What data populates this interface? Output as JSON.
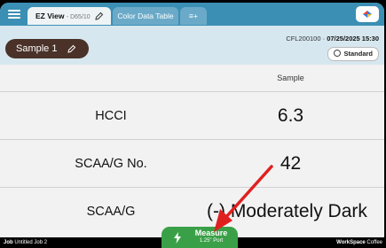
{
  "tabs": [
    {
      "label": "EZ View",
      "sub": "- D65/10"
    },
    {
      "label": "Color Data Table"
    },
    {
      "label": "≡+"
    }
  ],
  "header": {
    "sample_label": "Sample 1",
    "serial": "CFL200100 ·",
    "datetime": "07/25/2025 15:30",
    "standard_label": "Standard"
  },
  "table": {
    "column_header": "Sample",
    "rows": [
      {
        "label": "HCCI",
        "value": "6.3"
      },
      {
        "label": "SCAA/G No.",
        "value": "42"
      },
      {
        "label": "SCAA/G",
        "value": "(-) Moderately Dark"
      }
    ]
  },
  "status": {
    "job_key": "Job",
    "job_value": "Untitled Job 2",
    "workspace_key": "WorkSpace",
    "workspace_value": "Coffee"
  },
  "measure": {
    "label": "Measure",
    "port": "1.25\" Port"
  },
  "colors": {
    "tabbar": "#3b8fb4",
    "measure": "#3aa047",
    "sample_pill": "#4a3228",
    "arrow": "#e02020"
  }
}
